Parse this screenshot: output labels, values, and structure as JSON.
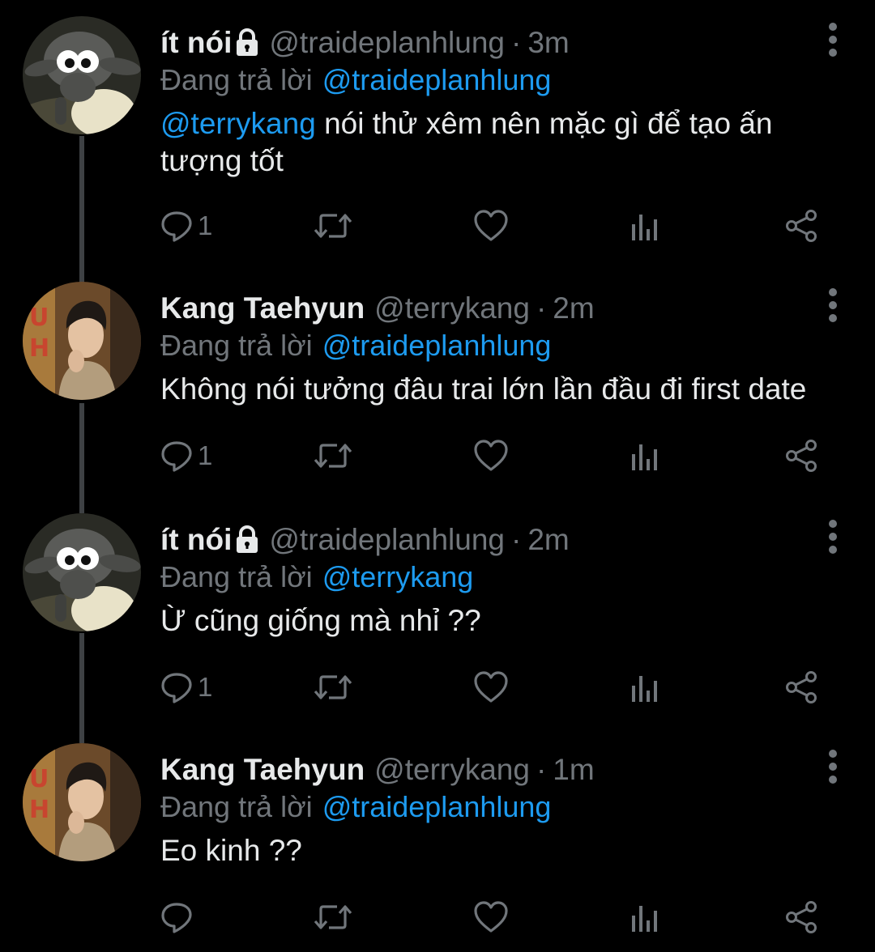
{
  "tweets": [
    {
      "display_name": "ít nói",
      "locked": true,
      "handle": "@traideplanhlung",
      "separator": "·",
      "time": "3m",
      "reply_prefix": "Đang trả lời",
      "reply_to": "@traideplanhlung",
      "mention": "@terrykang",
      "text": " nói thử xêm nên mặc gì để tạo ấn tượng tốt",
      "reply_count": "1",
      "avatar": "sheep-avatar"
    },
    {
      "display_name": "Kang Taehyun",
      "locked": false,
      "handle": "@terrykang",
      "separator": "·",
      "time": "2m",
      "reply_prefix": "Đang trả lời",
      "reply_to": "@traideplanhlung",
      "mention": "",
      "text": "Không nói tưởng đâu trai lớn lần đầu đi first date",
      "reply_count": "1",
      "avatar": "person-avatar"
    },
    {
      "display_name": "ít nói",
      "locked": true,
      "handle": "@traideplanhlung",
      "separator": "·",
      "time": "2m",
      "reply_prefix": "Đang trả lời",
      "reply_to": "@terrykang",
      "mention": "",
      "text": "Ừ cũng giống mà nhỉ ??",
      "reply_count": "1",
      "avatar": "sheep-avatar"
    },
    {
      "display_name": "Kang Taehyun",
      "locked": false,
      "handle": "@terrykang",
      "separator": "·",
      "time": "1m",
      "reply_prefix": "Đang trả lời",
      "reply_to": "@traideplanhlung",
      "mention": "",
      "text": "Eo kinh ??",
      "reply_count": "",
      "avatar": "person-avatar"
    }
  ],
  "icons": {
    "reply": "reply-icon",
    "retweet": "retweet-icon",
    "like": "heart-icon",
    "analytics": "analytics-icon",
    "share": "share-icon",
    "more": "more-vertical-icon",
    "lock": "lock-icon"
  },
  "colors": {
    "background": "#000000",
    "text": "#e7e9ea",
    "secondary": "#71767b",
    "link": "#1d9bf0",
    "thread_line": "#3e4144"
  }
}
